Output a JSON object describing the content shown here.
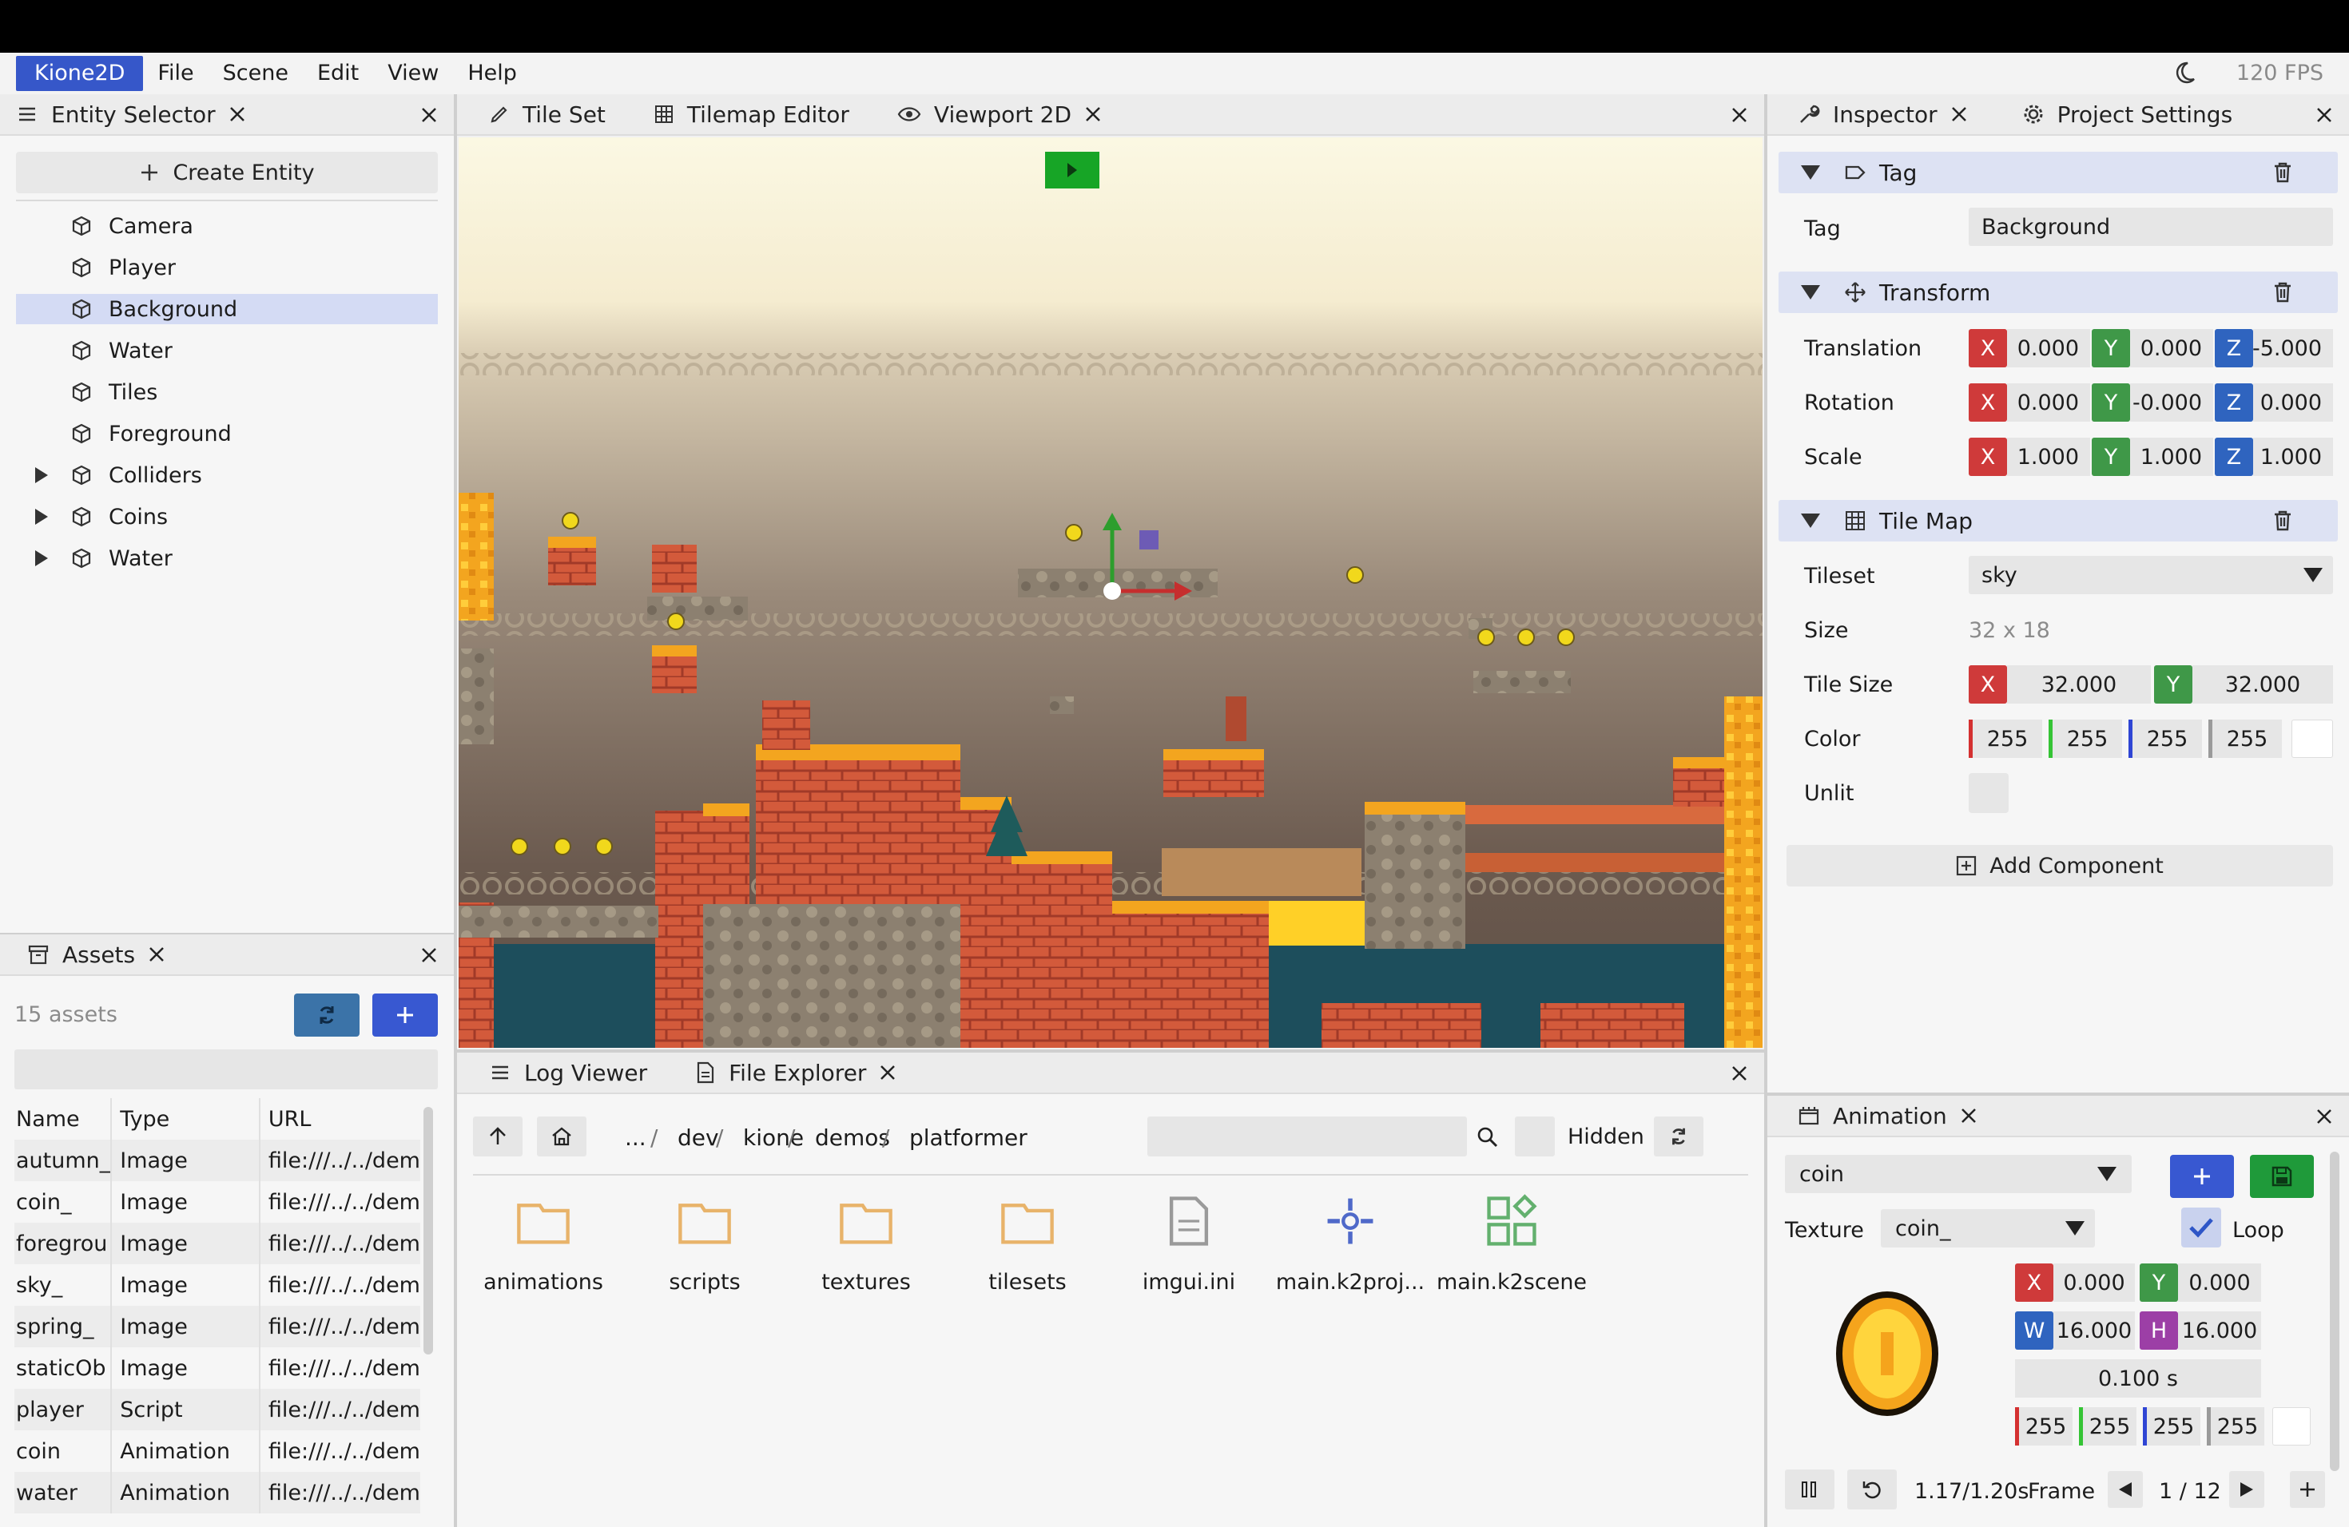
{
  "menu": {
    "brand": "Kione2D",
    "items": [
      "File",
      "Scene",
      "Edit",
      "View",
      "Help"
    ],
    "fps": "120 FPS"
  },
  "entity_panel": {
    "tab": "Entity Selector",
    "create_label": "Create Entity",
    "entities": [
      {
        "label": "Camera",
        "expandable": false,
        "selected": false
      },
      {
        "label": "Player",
        "expandable": false,
        "selected": false
      },
      {
        "label": "Background",
        "expandable": false,
        "selected": true
      },
      {
        "label": "Water",
        "expandable": false,
        "selected": false
      },
      {
        "label": "Tiles",
        "expandable": false,
        "selected": false
      },
      {
        "label": "Foreground",
        "expandable": false,
        "selected": false
      },
      {
        "label": "Colliders",
        "expandable": true,
        "selected": false
      },
      {
        "label": "Coins",
        "expandable": true,
        "selected": false
      },
      {
        "label": "Water",
        "expandable": true,
        "selected": false
      }
    ]
  },
  "viewport": {
    "tabs": [
      "Tile Set",
      "Tilemap Editor",
      "Viewport 2D"
    ],
    "active_tab": "Viewport 2D",
    "play_button": "play"
  },
  "inspector": {
    "tabs": [
      "Inspector",
      "Project Settings"
    ],
    "tag_section": "Tag",
    "tag_label": "Tag",
    "tag_value": "Background",
    "transform_section": "Transform",
    "translation_label": "Translation",
    "translation": {
      "x": "0.000",
      "y": "0.000",
      "z": "-5.000"
    },
    "rotation_label": "Rotation",
    "rotation": {
      "x": "0.000",
      "y": "-0.000",
      "z": "0.000"
    },
    "scale_label": "Scale",
    "scale": {
      "x": "1.000",
      "y": "1.000",
      "z": "1.000"
    },
    "tilemap_section": "Tile Map",
    "tileset_label": "Tileset",
    "tileset_value": "sky",
    "size_label": "Size",
    "size_value": "32 x 18",
    "tilesize_label": "Tile Size",
    "tilesize": {
      "x": "32.000",
      "y": "32.000"
    },
    "color_label": "Color",
    "color": [
      "255",
      "255",
      "255",
      "255"
    ],
    "unlit_label": "Unlit",
    "add_component": "Add Component",
    "axis": {
      "x": "X",
      "y": "Y",
      "z": "Z",
      "w": "W",
      "h": "H"
    }
  },
  "assets": {
    "tab": "Assets",
    "count": "15 assets",
    "columns": [
      "Name",
      "Type",
      "URL"
    ],
    "rows": [
      {
        "name": "autumn_",
        "type": "Image",
        "url": "file:///../../dem"
      },
      {
        "name": "coin_",
        "type": "Image",
        "url": "file:///../../dem"
      },
      {
        "name": "foregrou",
        "type": "Image",
        "url": "file:///../../dem"
      },
      {
        "name": "sky_",
        "type": "Image",
        "url": "file:///../../dem"
      },
      {
        "name": "spring_",
        "type": "Image",
        "url": "file:///../../dem"
      },
      {
        "name": "staticOb",
        "type": "Image",
        "url": "file:///../../dem"
      },
      {
        "name": "player",
        "type": "Script",
        "url": "file:///../../dem"
      },
      {
        "name": "coin",
        "type": "Animation",
        "url": "file:///../../dem"
      },
      {
        "name": "water",
        "type": "Animation",
        "url": "file:///../../dem"
      }
    ]
  },
  "file_explorer": {
    "tabs": [
      "Log Viewer",
      "File Explorer"
    ],
    "breadcrumb": [
      "...",
      "dev",
      "kione",
      "demos",
      "platformer"
    ],
    "hidden_label": "Hidden",
    "items": [
      {
        "name": "animations",
        "kind": "folder"
      },
      {
        "name": "scripts",
        "kind": "folder"
      },
      {
        "name": "textures",
        "kind": "folder"
      },
      {
        "name": "tilesets",
        "kind": "folder"
      },
      {
        "name": "imgui.ini",
        "kind": "file"
      },
      {
        "name": "main.k2proj...",
        "kind": "project"
      },
      {
        "name": "main.k2scene",
        "kind": "scene"
      }
    ]
  },
  "animation": {
    "tab": "Animation",
    "selected": "coin",
    "texture_label": "Texture",
    "texture_value": "coin_",
    "loop_label": "Loop",
    "pos": {
      "x": "0.000",
      "y": "0.000"
    },
    "size": {
      "w": "16.000",
      "h": "16.000"
    },
    "duration": "0.100 s",
    "color": [
      "255",
      "255",
      "255",
      "255"
    ],
    "time": "1.17/1.20s",
    "frame_label": "Frame",
    "frame": "1 / 12"
  }
}
